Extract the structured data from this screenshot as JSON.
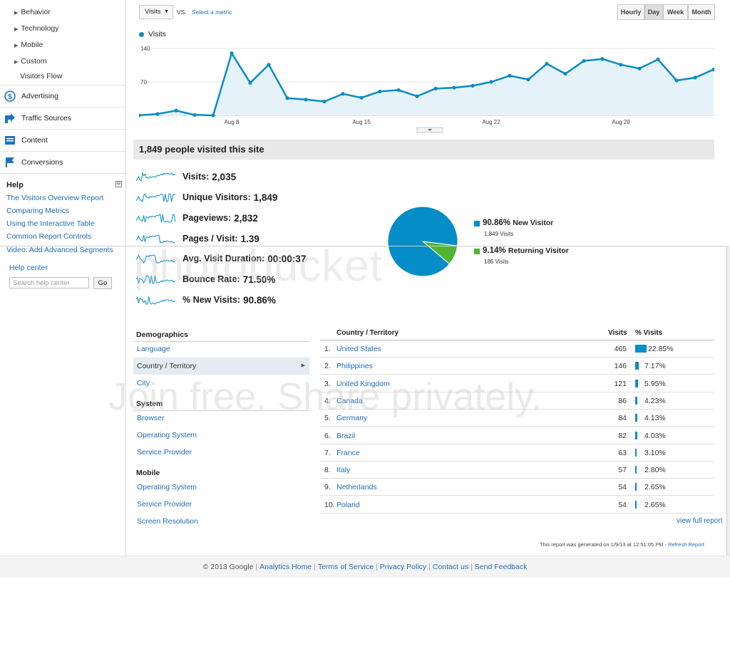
{
  "sidebar": {
    "subitems": [
      "Behavior",
      "Technology",
      "Mobile",
      "Custom"
    ],
    "visitors_flow": "Visitors Flow",
    "nav": [
      {
        "label": "Advertising",
        "icon": "dollar-icon"
      },
      {
        "label": "Traffic Sources",
        "icon": "traffic-arrow-icon"
      },
      {
        "label": "Content",
        "icon": "content-icon"
      },
      {
        "label": "Conversions",
        "icon": "flag-icon"
      }
    ],
    "help": {
      "title": "Help",
      "min": "⊖",
      "links": [
        "The Visitors Overview Report",
        "Comparing Metrics",
        "Using the Interactive Table",
        "Common Report Controls",
        "Video: Add Advanced Segments"
      ],
      "help_center": "Help center",
      "search_placeholder": "Search help center",
      "go": "Go"
    }
  },
  "toolbar": {
    "metric": "Visits",
    "vs": "VS.",
    "select_metric": "Select a metric",
    "granularity": [
      "Hourly",
      "Day",
      "Week",
      "Month"
    ],
    "active_granularity": "Day"
  },
  "chart_data": {
    "type": "line",
    "legend": "Visits",
    "x_labels": [
      "Aug 8",
      "Aug 15",
      "Aug 22",
      "Aug 29"
    ],
    "y_ticks": [
      "140",
      "70"
    ],
    "ylim": [
      0,
      140
    ],
    "values": [
      0,
      3,
      10,
      1,
      0,
      130,
      68,
      106,
      36,
      33,
      29,
      45,
      37,
      50,
      53,
      40,
      56,
      58,
      62,
      70,
      83,
      75,
      108,
      87,
      114,
      118,
      106,
      98,
      117,
      73,
      79,
      96
    ]
  },
  "summary": {
    "title": "1,849 people visited this site"
  },
  "metrics": [
    {
      "label": "Visits:",
      "value": "2,035"
    },
    {
      "label": "Unique Visitors:",
      "value": "1,849"
    },
    {
      "label": "Pageviews:",
      "value": "2,832"
    },
    {
      "label": "Pages / Visit:",
      "value": "1.39"
    },
    {
      "label": "Avg. Visit Duration:",
      "value": "00:00:37"
    },
    {
      "label": "Bounce Rate:",
      "value": "71.50%"
    },
    {
      "label": "% New Visits:",
      "value": "90.86%"
    }
  ],
  "pie": {
    "slices": [
      {
        "pct": "90.86%",
        "label": "New Visitor",
        "count": "1,849 Visits",
        "value": 90.86,
        "color": "#058dc7"
      },
      {
        "pct": "9.14%",
        "label": "Returning Visitor",
        "count": "186 Visits",
        "value": 9.14,
        "color": "#50b432"
      }
    ]
  },
  "demographics": {
    "sections": [
      {
        "title": "Demographics",
        "items": [
          "Language",
          "Country / Territory",
          "City"
        ]
      },
      {
        "title": "System",
        "items": [
          "Browser",
          "Operating System",
          "Service Provider"
        ]
      },
      {
        "title": "Mobile",
        "items": [
          "Operating System",
          "Service Provider",
          "Screen Resolution"
        ]
      }
    ],
    "selected": "Country / Territory"
  },
  "table": {
    "headers": {
      "country": "Country / Territory",
      "visits": "Visits",
      "pct": "% Visits"
    },
    "rows": [
      {
        "n": "1.",
        "country": "United States",
        "visits": "465",
        "pct": "22.85%",
        "share": 22.85
      },
      {
        "n": "2.",
        "country": "Philippines",
        "visits": "146",
        "pct": "7.17%",
        "share": 7.17
      },
      {
        "n": "3.",
        "country": "United Kingdom",
        "visits": "121",
        "pct": "5.95%",
        "share": 5.95
      },
      {
        "n": "4.",
        "country": "Canada",
        "visits": "86",
        "pct": "4.23%",
        "share": 4.23
      },
      {
        "n": "5.",
        "country": "Germany",
        "visits": "84",
        "pct": "4.13%",
        "share": 4.13
      },
      {
        "n": "6.",
        "country": "Brazil",
        "visits": "82",
        "pct": "4.03%",
        "share": 4.03
      },
      {
        "n": "7.",
        "country": "France",
        "visits": "63",
        "pct": "3.10%",
        "share": 3.1
      },
      {
        "n": "8.",
        "country": "Italy",
        "visits": "57",
        "pct": "2.80%",
        "share": 2.8
      },
      {
        "n": "9.",
        "country": "Netherlands",
        "visits": "54",
        "pct": "2.65%",
        "share": 2.65
      },
      {
        "n": "10.",
        "country": "Poland",
        "visits": "54",
        "pct": "2.65%",
        "share": 2.65
      }
    ],
    "view_full": "view full report"
  },
  "generated": {
    "text": "This report was generated on 1/9/13 at 12:51:05 PM -",
    "refresh": "Refresh Report"
  },
  "footer": {
    "copyright": "© 2013 Google",
    "links": [
      "Analytics Home",
      "Terms of Service",
      "Privacy Policy",
      "Contact us",
      "Send Feedback"
    ]
  },
  "watermark": {
    "brand": "photobucket",
    "tagline": "Join free. Share privately."
  }
}
